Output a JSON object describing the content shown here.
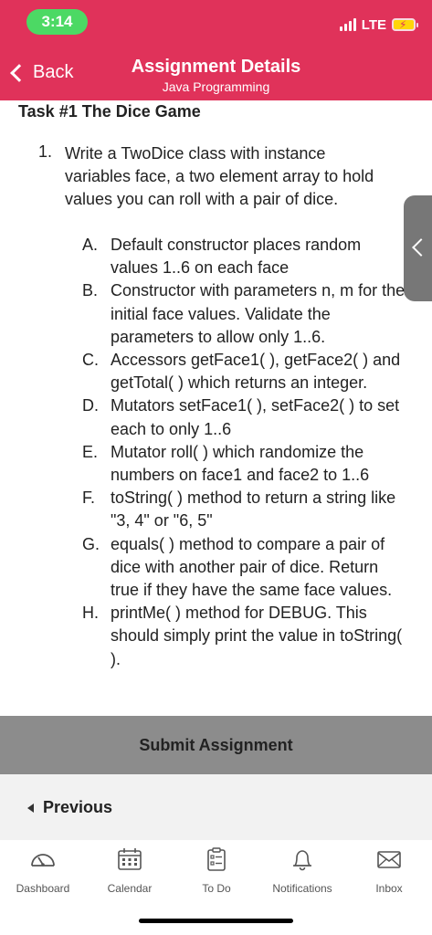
{
  "status": {
    "time": "3:14",
    "network": "LTE"
  },
  "nav": {
    "back_label": "Back",
    "title": "Assignment Details",
    "subtitle": "Java Programming"
  },
  "task": {
    "title": "Task #1 The Dice Game",
    "number": "1.",
    "text": "Write a TwoDice class with instance variables face, a two element array to hold values you can roll with a pair of dice.",
    "items": [
      {
        "letter": "A.",
        "text": "Default constructor places random values 1..6 on each face"
      },
      {
        "letter": "B.",
        "text": "Constructor with parameters n, m for the initial face values. Validate the parameters to allow only 1..6."
      },
      {
        "letter": "C.",
        "text": "Accessors getFace1( ), getFace2( ) and getTotal( ) which returns an integer."
      },
      {
        "letter": "D.",
        "text": "Mutators setFace1( ), setFace2( ) to set each to only 1..6"
      },
      {
        "letter": "E.",
        "text": "Mutator roll( ) which randomize the numbers on face1 and face2 to 1..6"
      },
      {
        "letter": "F.",
        "text": "toString( ) method to return a string like \"3, 4\" or \"6, 5\""
      },
      {
        "letter": "G.",
        "text": "equals( ) method to compare a pair of dice with another pair of dice. Return true if they have the same face values."
      },
      {
        "letter": "H.",
        "text": "printMe( ) method for DEBUG. This should simply print the value in toString( )."
      }
    ]
  },
  "submit_label": "Submit Assignment",
  "previous_label": "Previous",
  "tabs": [
    {
      "label": "Dashboard",
      "icon": "dashboard-icon"
    },
    {
      "label": "Calendar",
      "icon": "calendar-icon"
    },
    {
      "label": "To Do",
      "icon": "todo-icon"
    },
    {
      "label": "Notifications",
      "icon": "bell-icon"
    },
    {
      "label": "Inbox",
      "icon": "inbox-icon"
    }
  ],
  "colors": {
    "header": "#e0325a",
    "submit_bar": "#8c8c8c",
    "status_pill": "#4cd964",
    "battery": "#ffd60a"
  }
}
